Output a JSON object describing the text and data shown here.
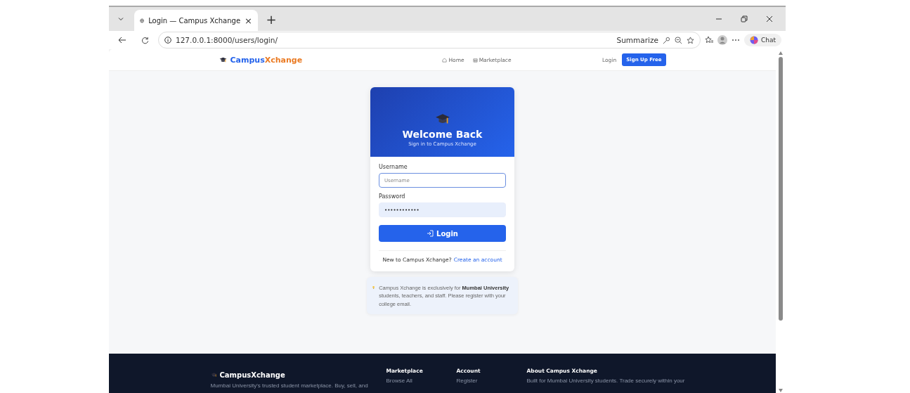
{
  "browser": {
    "tab": {
      "title": "Login — Campus Xchange",
      "close": "×",
      "selected": true
    },
    "new_tab": "+",
    "address": "127.0.0.1:8000/users/login/",
    "summarize": "Summarize",
    "chat": "Chat"
  },
  "navbar": {
    "brand": [
      "Campus",
      "Xchange"
    ],
    "links": [
      "Home",
      "Marketplace"
    ],
    "login": "Login",
    "signup": "Sign Up Free"
  },
  "card": {
    "title": "Welcome Back",
    "subtitle": "Sign in to Campus Xchange",
    "fields": [
      {
        "label": "Username",
        "placeholder": "Username",
        "focused": true,
        "filled": false
      },
      {
        "label": "Password",
        "value": "••••••••••••",
        "focused": false,
        "filled": true
      }
    ],
    "button": "Login",
    "prompt": "New to Campus Xchange?",
    "link": "Create an account"
  },
  "notice": "Campus Xchange is exclusively for **Mumbai University** students, teachers, and staff. Please register with your college email.",
  "footer": {
    "brand": "CampusXchange",
    "tagline": "Mumbai University's trusted student marketplace. Buy, sell, and",
    "columns": [
      {
        "heading": "Marketplace",
        "items": [
          "Browse All"
        ]
      },
      {
        "heading": "Account",
        "items": [
          "Register"
        ]
      },
      {
        "heading": "About Campus Xchange",
        "text": "Built for Mumbai University students. Trade securely within your"
      }
    ]
  }
}
